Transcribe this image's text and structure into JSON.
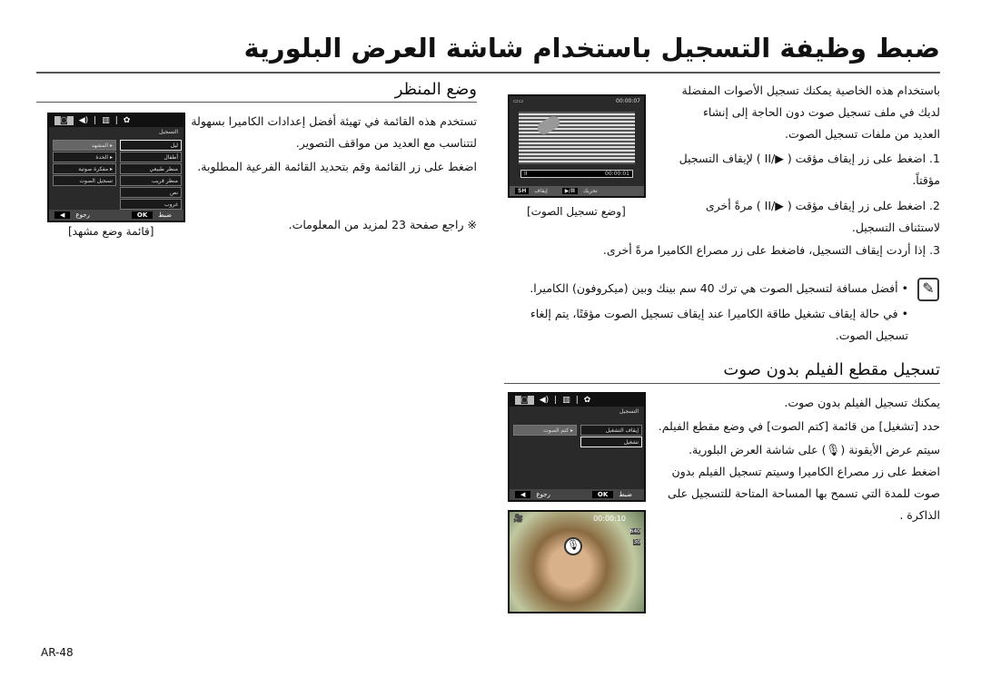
{
  "title": "ضبط وظيفة التسجيل باستخدام شاشة العرض البلورية",
  "voice": {
    "intro": "باستخدام هذه الخاصية يمكنك تسجيل الأصوات المفضلة لديك في ملف تسجيل صوت دون الحاجة إلى إنشاء العديد من ملفات تسجيل الصوت.",
    "steps": [
      "1. اضغط على زر إيقاف مؤقت ( ▶/II ) لإيقاف التسجيل مؤقتاً.",
      "2. اضغط على زر إيقاف مؤقت ( ▶/II ) مرةً أخرى لاستئناف التسجيل.",
      "3. إذا أردت إيقاف التسجيل، فاضغط على زر مصراع الكاميرا مرةً أخرى."
    ],
    "screen": {
      "time_top": "00:00:07",
      "time_bar": "00:00:01",
      "stop_label": "إيقاف",
      "stop_key": "SH",
      "move_label": "تحريك",
      "pause_key": "▶/II"
    },
    "caption": "[وضع تسجيل الصوت]"
  },
  "notes": [
    "أفضل مسافة لتسجيل الصوت هي ترك 40 سم بينك وبين (ميكروفون) الكاميرا.",
    "في حالة إيقاف تشغيل طاقة الكاميرا عند إيقاف تسجيل الصوت مؤقتًا، يتم إلغاء تسجيل الصوت."
  ],
  "mute": {
    "heading": "تسجيل مقطع الفيلم بدون صوت",
    "lines": [
      "يمكنك تسجيل الفيلم بدون صوت.",
      "حدد [تشغيل] من قائمة [كتم الصوت] في وضع مقطع الفيلم.",
      "سيتم عرض الأيقونة (🎙) على شاشة العرض البلورية. اضغط على زر مصراع الكاميرا وسيتم تسجيل الفيلم بدون صوت للمدة التي تسمح بها المساحة المتاحة للتسجيل على الذاكرة ."
    ],
    "menu": {
      "section": "التسجيل",
      "left_item": "▸ كتم الصوت",
      "options": [
        "إيقاف التشغيل",
        "تشغيل"
      ],
      "ok": "OK",
      "ok_label": "ضبط",
      "back_label": "رجوع"
    },
    "photo": {
      "time": "00:00:10",
      "badges": [
        "640",
        "30"
      ]
    }
  },
  "scene": {
    "heading": "وضع المنظر",
    "lines": [
      "تستخدم هذه القائمة في تهيئة أفضل إعدادات الكاميرا بسهولة لتتناسب مع العديد من مواقف التصوير.",
      "اضغط على زر القائمة وقم بتحديد القائمة الفرعية المطلوبة."
    ],
    "ref": "※ راجع صفحة 23 لمزيد من المعلومات.",
    "menu": {
      "section": "التسجيل",
      "left_items": [
        "▸ المشهد",
        "▸ الحدة",
        "▸ مفكرة صوتية",
        "تسجيل الصوت"
      ],
      "options": [
        "ليل",
        "أطفال",
        "منظر طبيعي",
        "منظر قريب",
        "نص",
        "غروب"
      ],
      "ok": "OK",
      "ok_label": "ضبط",
      "back_label": "رجوع"
    },
    "caption": "[قائمة وضع مشهد]"
  },
  "page_number": "AR-48"
}
